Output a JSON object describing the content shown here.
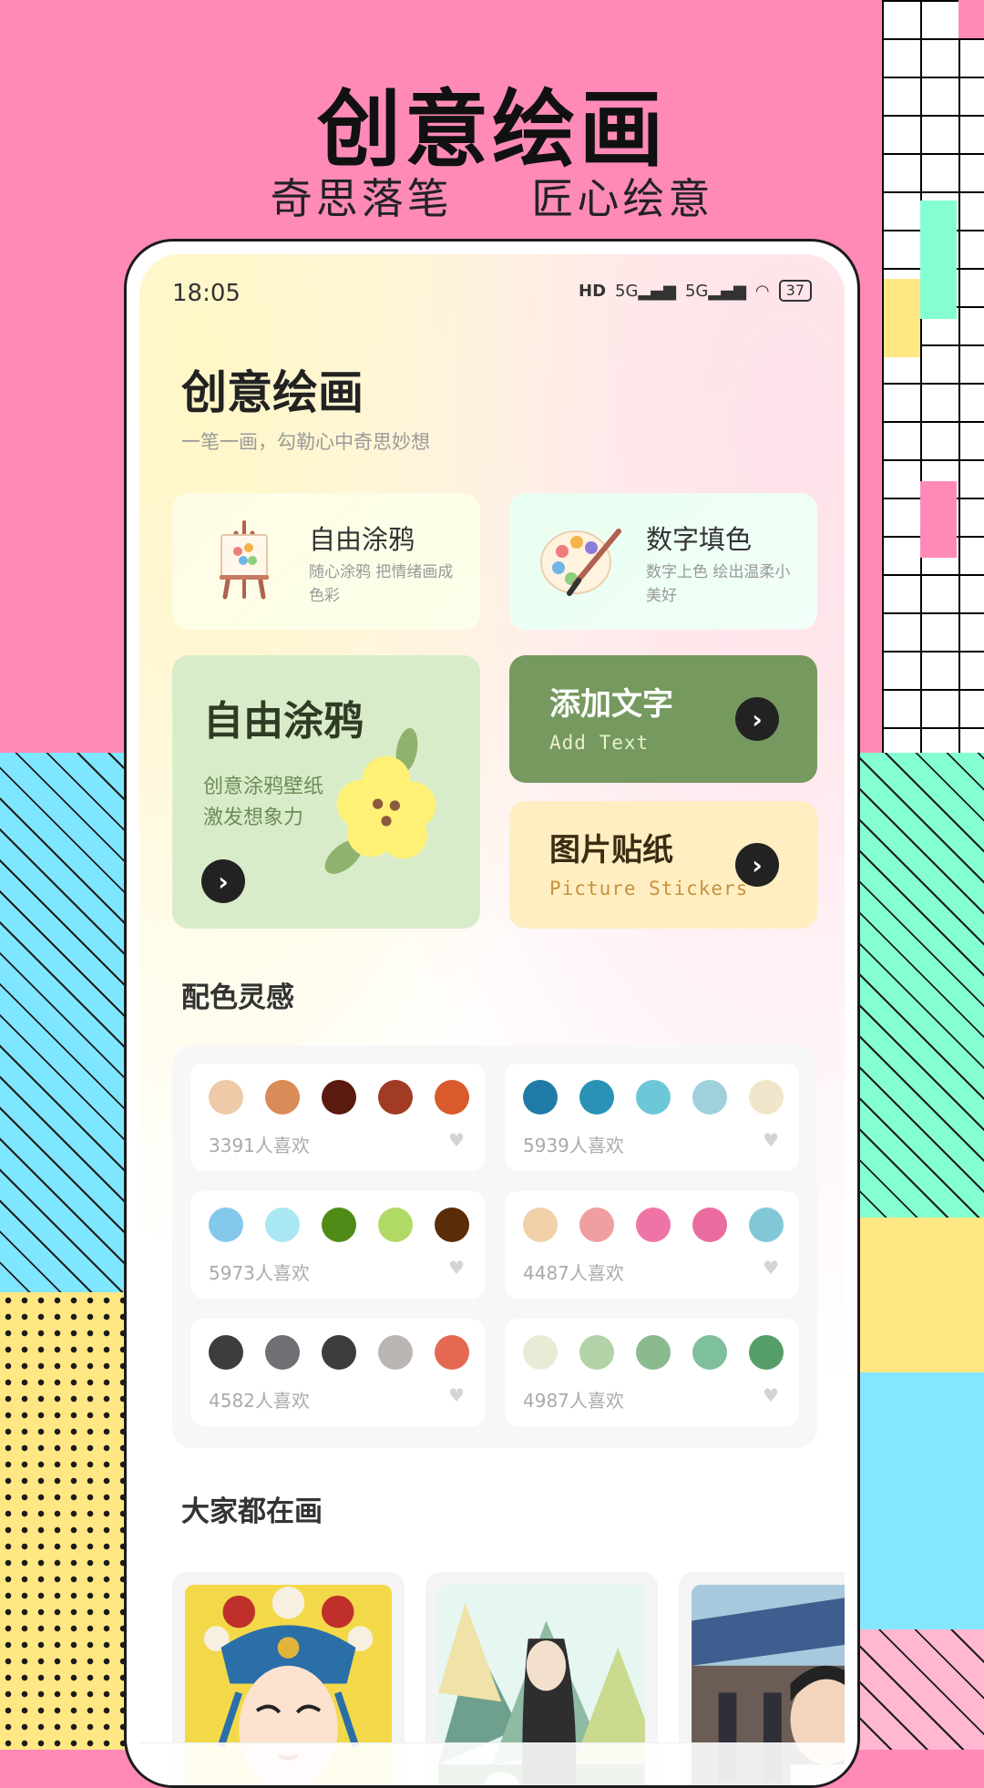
{
  "hero": {
    "title": "创意绘画",
    "subtitle_left": "奇思落笔",
    "subtitle_right": "匠心绘意"
  },
  "status_bar": {
    "time": "18:05",
    "hd": "HD",
    "sim1": "5G",
    "sim2": "5G",
    "battery": "37"
  },
  "app": {
    "title": "创意绘画",
    "subtitle": "一笔一画，勾勒心中奇思妙想"
  },
  "features": [
    {
      "title": "自由涂鸦",
      "desc": "随心涂鸦  把情绪画成色彩",
      "icon": "easel-icon"
    },
    {
      "title": "数字填色",
      "desc": "数字上色  绘出温柔小美好",
      "icon": "palette-brush-icon"
    }
  ],
  "big_tile": {
    "title": "自由涂鸦",
    "line1": "创意涂鸦壁纸",
    "line2": "激发想象力",
    "icon": "chevron-right-icon"
  },
  "tiles": [
    {
      "title": "添加文字",
      "subtitle": "Add Text",
      "title_color": "#ffffff",
      "sub_color": "#e8f0c9"
    },
    {
      "title": "图片贴纸",
      "subtitle": "Picture Stickers",
      "title_color": "#3a2d12",
      "sub_color": "#c8923b"
    }
  ],
  "palette_section": {
    "title": "配色灵感",
    "palettes": [
      {
        "likes": "3391人喜欢",
        "colors": [
          "#efcaa8",
          "#d98b58",
          "#5b1a0f",
          "#a13b24",
          "#d95a2b"
        ]
      },
      {
        "likes": "5939人喜欢",
        "colors": [
          "#1f7ba6",
          "#2a92b4",
          "#6cc8d8",
          "#9fd0dc",
          "#f1e5cb"
        ]
      },
      {
        "likes": "5973人喜欢",
        "colors": [
          "#84c8ec",
          "#a9e8f2",
          "#4f8c17",
          "#b1d965",
          "#5a2c08"
        ]
      },
      {
        "likes": "4487人喜欢",
        "colors": [
          "#f1d0a8",
          "#ef9fa1",
          "#ee74a6",
          "#ea6b9d",
          "#81c7d7"
        ]
      },
      {
        "likes": "4582人喜欢",
        "colors": [
          "#3c3d3d",
          "#6e7073",
          "#3b3e3b",
          "#bbb6b4",
          "#e46852"
        ]
      },
      {
        "likes": "4987人喜欢",
        "colors": [
          "#e9ebd7",
          "#b4d2a8",
          "#8aba8d",
          "#7ebf9c",
          "#559e67"
        ]
      }
    ]
  },
  "gallery_section": {
    "title": "大家都在画",
    "items": [
      {
        "name": "opera-mask-painting"
      },
      {
        "name": "mountain-figure-painting"
      },
      {
        "name": "courtyard-figure-painting"
      }
    ]
  }
}
